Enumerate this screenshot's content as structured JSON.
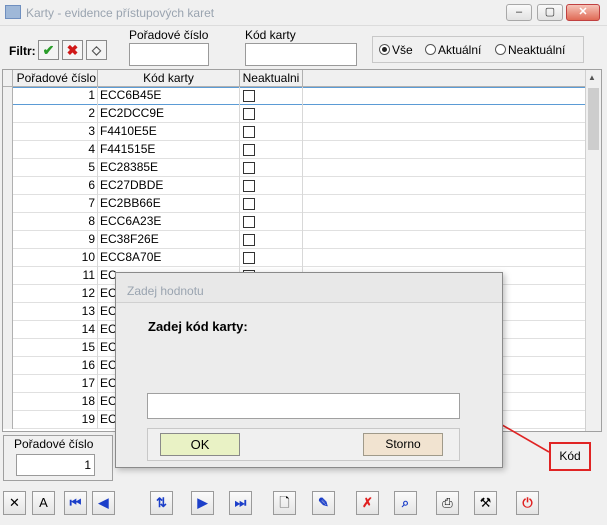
{
  "window": {
    "title": "Karty - evidence přístupových karet",
    "min_label": "–",
    "max_label": "▢",
    "close_label": "✕"
  },
  "filter": {
    "label": "Filtr:",
    "poradove_cislo_label": "Pořadové číslo",
    "poradove_cislo_value": "",
    "kod_karty_label": "Kód karty",
    "kod_karty_value": "",
    "radio_options": [
      "Vše",
      "Aktuální",
      "Neaktuální"
    ],
    "radio_selected": "Vše"
  },
  "grid": {
    "columns": [
      "Pořadové číslo",
      "Kód karty",
      "Neaktualni"
    ],
    "rows": [
      {
        "num": "1",
        "code": "ECC6B45E",
        "neaktualni": false
      },
      {
        "num": "2",
        "code": "EC2DCC9E",
        "neaktualni": false
      },
      {
        "num": "3",
        "code": "F4410E5E",
        "neaktualni": false
      },
      {
        "num": "4",
        "code": "F441515E",
        "neaktualni": false
      },
      {
        "num": "5",
        "code": "EC28385E",
        "neaktualni": false
      },
      {
        "num": "6",
        "code": "EC27DBDE",
        "neaktualni": false
      },
      {
        "num": "7",
        "code": "EC2BB66E",
        "neaktualni": false
      },
      {
        "num": "8",
        "code": "ECC6A23E",
        "neaktualni": false
      },
      {
        "num": "9",
        "code": "EC38F26E",
        "neaktualni": false
      },
      {
        "num": "10",
        "code": "ECC8A70E",
        "neaktualni": false
      },
      {
        "num": "11",
        "code": "EC",
        "neaktualni": false
      },
      {
        "num": "12",
        "code": "EC",
        "neaktualni": false
      },
      {
        "num": "13",
        "code": "EC",
        "neaktualni": false
      },
      {
        "num": "14",
        "code": "EC",
        "neaktualni": false
      },
      {
        "num": "15",
        "code": "EC",
        "neaktualni": false
      },
      {
        "num": "16",
        "code": "EC",
        "neaktualni": false
      },
      {
        "num": "17",
        "code": "EC",
        "neaktualni": false
      },
      {
        "num": "18",
        "code": "EC",
        "neaktualni": false
      },
      {
        "num": "19",
        "code": "EC",
        "neaktualni": false
      }
    ]
  },
  "detail": {
    "label": "Pořadové číslo",
    "value": "1"
  },
  "kod_button": {
    "label": "Kód"
  },
  "toolbar": {
    "buttons": [
      {
        "name": "close-tool-button",
        "glyph": "✕"
      },
      {
        "name": "font-tool-button",
        "glyph": "A"
      },
      {
        "name": "first-record-button",
        "glyph": "⏮"
      },
      {
        "name": "prev-record-button",
        "glyph": "◀"
      },
      {
        "name": "sort-button",
        "glyph": "⇅"
      },
      {
        "name": "next-record-button",
        "glyph": "▶"
      },
      {
        "name": "last-record-button",
        "glyph": "⏭"
      },
      {
        "name": "new-record-button",
        "glyph": "🗋"
      },
      {
        "name": "edit-record-button",
        "glyph": "✎"
      },
      {
        "name": "delete-record-button",
        "glyph": "✗"
      },
      {
        "name": "search-record-button",
        "glyph": "⌕"
      },
      {
        "name": "print-button",
        "glyph": "⎙"
      },
      {
        "name": "tools-button",
        "glyph": "⚒"
      },
      {
        "name": "power-button",
        "glyph": "⏻"
      }
    ]
  },
  "dialog": {
    "title": "Zadej hodnotu",
    "prompt": "Zadej kód karty:",
    "input_value": "",
    "ok_label": "OK",
    "storno_label": "Storno"
  },
  "colors": {
    "annotation": "#e02424",
    "selection": "#5b9bd5",
    "nav_icon": "#1c3fc9"
  }
}
